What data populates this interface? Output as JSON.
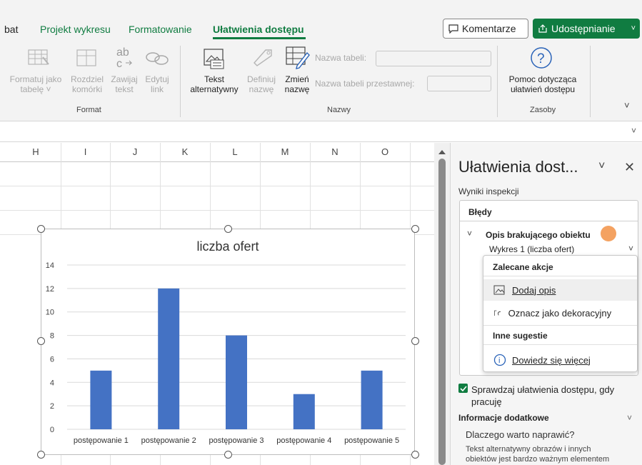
{
  "tabs": [
    {
      "label": "bat",
      "active": false
    },
    {
      "label": "Projekt wykresu",
      "active": false
    },
    {
      "label": "Formatowanie",
      "active": false
    },
    {
      "label": "Ułatwienia dostępu",
      "active": true
    }
  ],
  "header_buttons": {
    "comment": "Komentarze",
    "share": "Udostępnianie"
  },
  "ribbon": {
    "format_group": {
      "label": "Format",
      "buttons": [
        {
          "line1": "Formatuj jako",
          "line2": "tabelę ˅",
          "icon": "table-format-icon"
        },
        {
          "line1": "Rozdziel",
          "line2": "komórki",
          "icon": "split-cells-icon"
        },
        {
          "line1": "Zawijaj",
          "line2": "tekst",
          "icon": "wrap-text-icon"
        },
        {
          "line1": "Edytuj",
          "line2": "link",
          "icon": "edit-link-icon"
        }
      ]
    },
    "names_group": {
      "label": "Nazwy",
      "buttons": [
        {
          "line1": "Tekst",
          "line2": "alternatywny",
          "icon": "alt-text-icon"
        },
        {
          "line1": "Definiuj",
          "line2": "nazwę",
          "icon": "define-name-icon"
        },
        {
          "line1": "Zmień",
          "line2": "nazwę",
          "icon": "rename-icon"
        }
      ],
      "table_name_label": "Nazwa tabeli:",
      "pivot_name_label": "Nazwa tabeli przestawnej:"
    },
    "resources_group": {
      "label": "Zasoby",
      "help_line1": "Pomoc dotycząca",
      "help_line2": "ułatwień dostępu"
    }
  },
  "columns": [
    "H",
    "I",
    "J",
    "K",
    "L",
    "M",
    "N",
    "O"
  ],
  "chart_data": {
    "type": "bar",
    "title": "liczba ofert",
    "categories": [
      "postępowanie 1",
      "postępowanie 2",
      "postępowanie 3",
      "postępowanie 4",
      "postępowanie 5"
    ],
    "values": [
      5,
      12,
      8,
      3,
      5
    ],
    "ylim": [
      0,
      14
    ],
    "yticks": [
      "0",
      "2",
      "4",
      "6",
      "8",
      "10",
      "12",
      "14"
    ],
    "bar_color": "#4472c4",
    "grid": true
  },
  "pane": {
    "title": "Ułatwienia dost...",
    "subtitle": "Wyniki inspekcji",
    "errors_heading": "Błędy",
    "issue": "Opis brakującego obiektu",
    "issue_item": "Wykres 1 (liczba ofert)",
    "recommended_heading": "Zalecane akcje",
    "action_add": "Dodaj opis",
    "action_decorative": "Oznacz jako dekoracyjny",
    "other_heading": "Inne sugestie",
    "learn_more": "Dowiedz się więcej",
    "checkbox_line1": "Sprawdzaj ułatwienia dostępu, gdy",
    "checkbox_line2": "pracuję",
    "extra_heading": "Informacje dodatkowe",
    "why_fix": "Dlaczego warto naprawić?",
    "explain_line1": "Tekst alternatywny obrazów i innych",
    "explain_line2": "obiektów jest bardzo ważnym elementem"
  },
  "colors": {
    "accent": "#107c41",
    "marker": "#f4a261"
  }
}
